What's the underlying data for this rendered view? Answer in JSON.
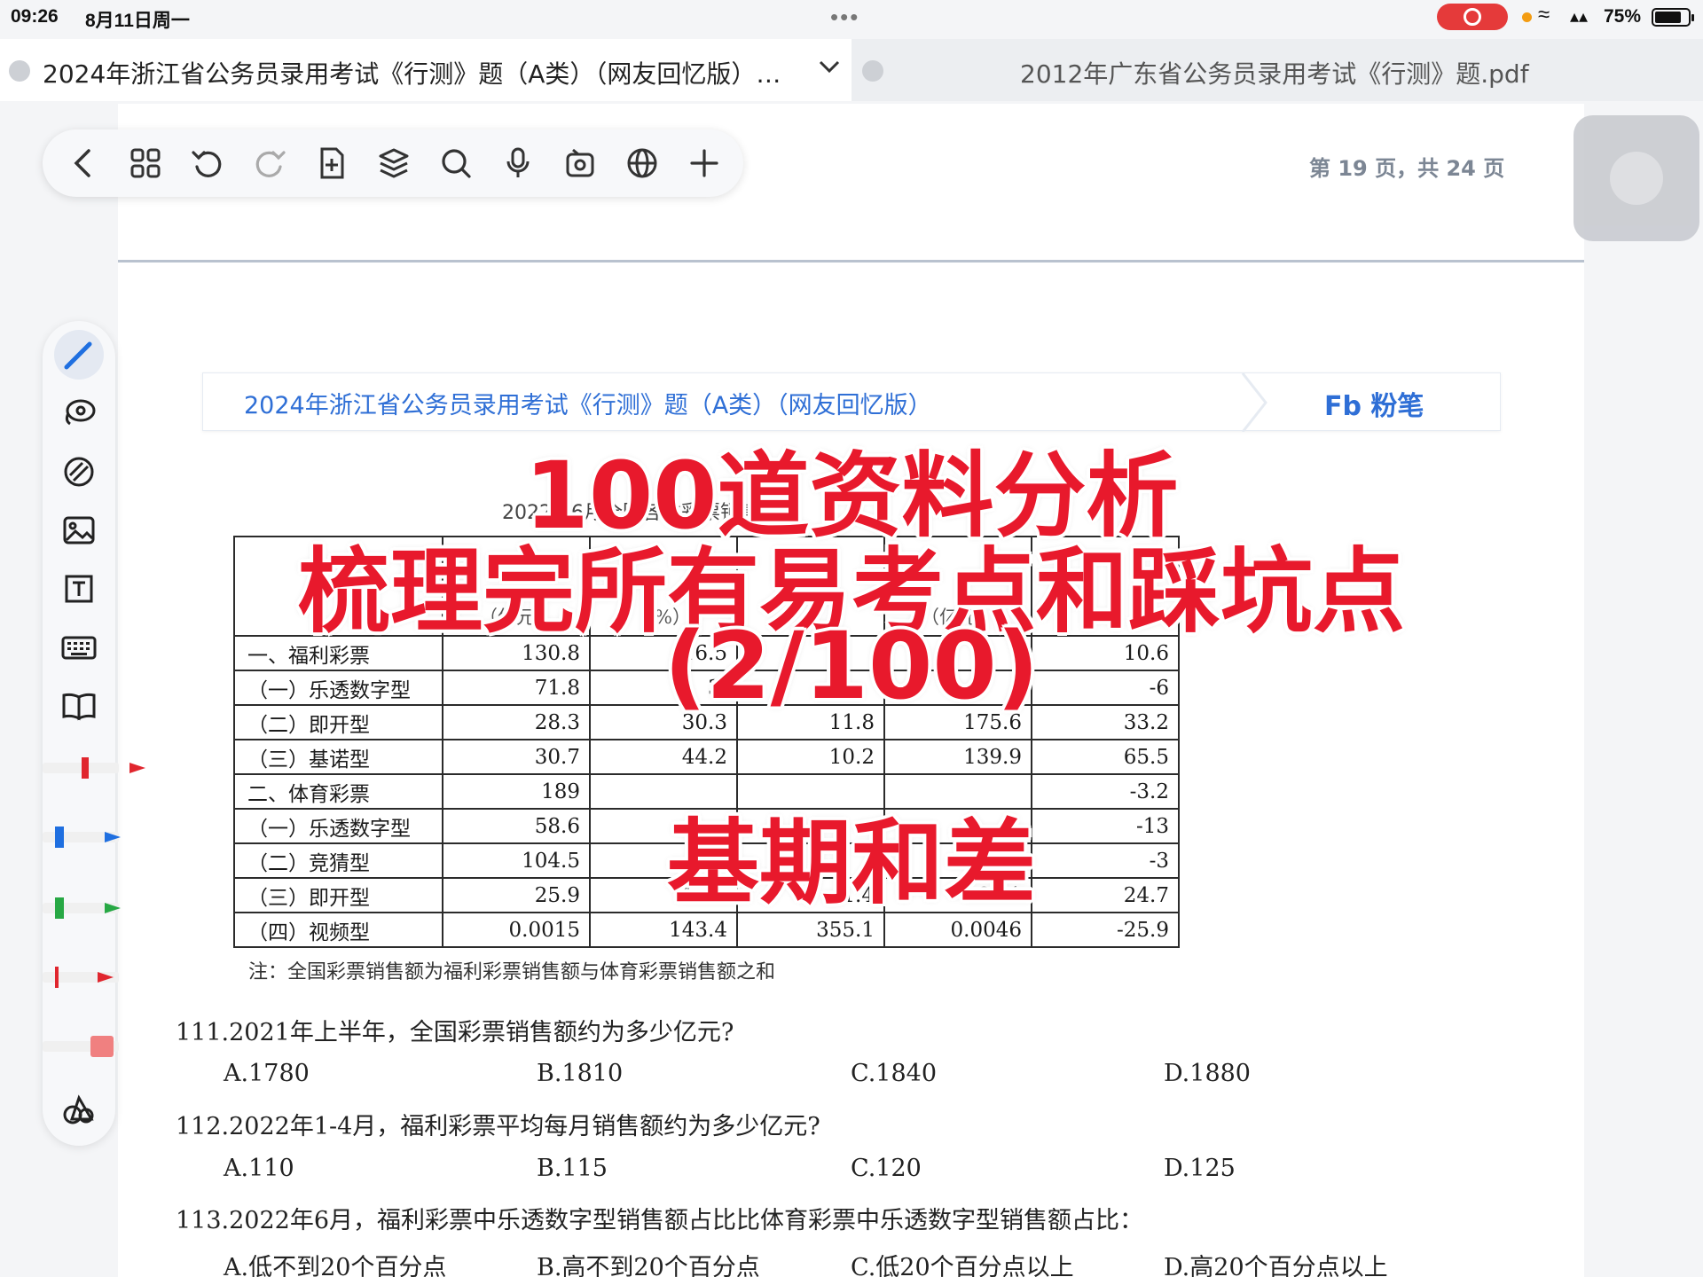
{
  "status_bar": {
    "time": "09:26",
    "date": "8月11日周一",
    "more_dots": "•••",
    "battery_percent": "75%",
    "battery_level": 0.75
  },
  "tabs": [
    {
      "label": "2024年浙江省公务员录用考试《行测》题（A类）（网友回忆版）…",
      "active": true
    },
    {
      "label": "2012年广东省公务员录用考试《行测》题.pdf",
      "active": false
    }
  ],
  "toolbar": {
    "icons": [
      "back-icon",
      "grid-icon",
      "undo-icon",
      "redo-icon",
      "add-page-icon",
      "layers-icon",
      "search-icon",
      "microphone-icon",
      "record-icon",
      "globe-icon",
      "plus-icon"
    ]
  },
  "page_indicator": "第 19 页，共 24 页",
  "sidebar": {
    "tools": [
      "pen-icon",
      "lasso-icon",
      "eraser-icon",
      "image-icon",
      "text-box-icon",
      "keyboard-icon",
      "book-icon"
    ],
    "pen_colors": [
      "#e0262e",
      "#1f6fe0",
      "#27a844",
      "#e0262e",
      "#f08080"
    ],
    "bottom_tool": "shapes-icon"
  },
  "document": {
    "header_title": "2024年浙江省公务员录用考试《行测》题（A类）（网友回忆版）",
    "brand": "Fb 粉笔",
    "table_caption": "2022年6月全国各类彩票销售情况",
    "table_header_units": [
      "（亿元）",
      "（%）",
      "（",
      "（亿元）",
      "（%）"
    ],
    "table_rows": [
      {
        "label": "一、福利彩票",
        "c1": "130.8",
        "c2": "16.5",
        "c3": "",
        "c4": "",
        "c5": "10.6"
      },
      {
        "label": "（一）乐透数字型",
        "c1": "71.8",
        "c2": "3.",
        "c3": "",
        "c4": "",
        "c5": "-6"
      },
      {
        "label": "（二）即开型",
        "c1": "28.3",
        "c2": "30.3",
        "c3": "11.8",
        "c4": "175.6",
        "c5": "33.2"
      },
      {
        "label": "（三）基诺型",
        "c1": "30.7",
        "c2": "44.2",
        "c3": "10.2",
        "c4": "139.9",
        "c5": "65.5"
      },
      {
        "label": "二、体育彩票",
        "c1": "189",
        "c2": "",
        "c3": "",
        "c4": "",
        "c5": "-3.2"
      },
      {
        "label": "（一）乐透数字型",
        "c1": "58.6",
        "c2": "",
        "c3": "",
        "c4": "",
        "c5": "-13"
      },
      {
        "label": "（二）竞猜型",
        "c1": "104.5",
        "c2": "",
        "c3": "",
        "c4": "",
        "c5": "-3"
      },
      {
        "label": "（三）即开型",
        "c1": "25.9",
        "c2": "18.5",
        "c3": "1.4",
        "c4": "161.1",
        "c5": "24.7"
      },
      {
        "label": "（四）视频型",
        "c1": "0.0015",
        "c2": "143.4",
        "c3": "355.1",
        "c4": "0.0046",
        "c5": "-25.9"
      }
    ],
    "table_note": "注：全国彩票销售额为福利彩票销售额与体育彩票销售额之和",
    "questions": [
      {
        "text": "111.2021年上半年，全国彩票销售额约为多少亿元?",
        "options": [
          "A.1780",
          "B.1810",
          "C.1840",
          "D.1880"
        ]
      },
      {
        "text": "112.2022年1-4月，福利彩票平均每月销售额约为多少亿元?",
        "options": [
          "A.110",
          "B.115",
          "C.120",
          "D.125"
        ]
      },
      {
        "text": "113.2022年6月，福利彩票中乐透数字型销售额占比比体育彩票中乐透数字型销售额占比：",
        "options": [
          "A.低不到20个百分点",
          "B.高不到20个百分点",
          "C.低20个百分点以上",
          "D.高20个百分点以上"
        ]
      }
    ]
  },
  "overlay": {
    "line1": "100道资料分析",
    "line2": "梳理完所有易考点和踩坑点",
    "line3": "(2/100)",
    "line4": "基期和差"
  }
}
